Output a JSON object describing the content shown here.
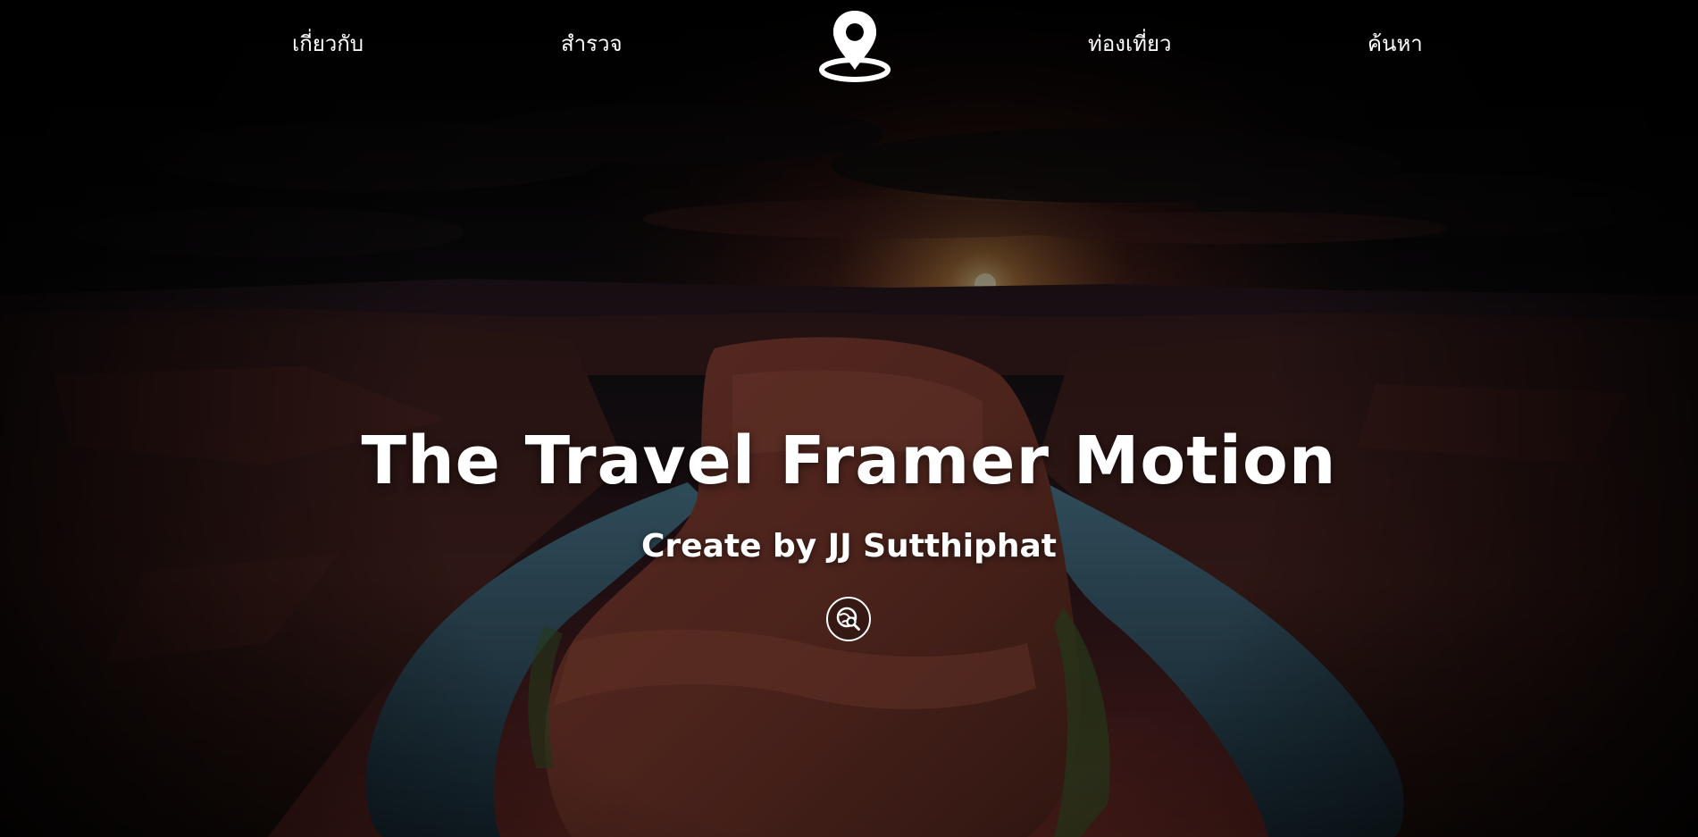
{
  "nav": {
    "items": [
      {
        "label": "เกี่ยวกับ"
      },
      {
        "label": "สำรวจ"
      },
      {
        "label": "ท่องเที่ยว"
      },
      {
        "label": "ค้นหา"
      }
    ],
    "logo_icon": "map-pin-icon"
  },
  "hero": {
    "title": "The Travel Framer Motion",
    "subtitle": "Create by JJ Sutthiphat",
    "explore_icon": "search-globe-icon",
    "background": "horseshoe-bend-canyon-sunset-photo"
  },
  "colors": {
    "text": "#ffffff",
    "overlay": "#000000",
    "rock": "#7a3b30",
    "river": "#35586e",
    "sun": "#ffd27a"
  }
}
